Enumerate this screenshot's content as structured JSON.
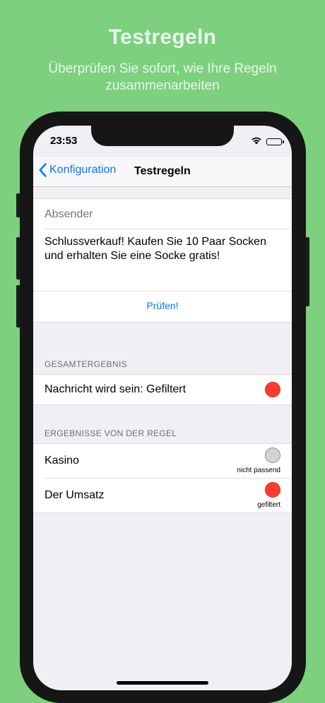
{
  "promo": {
    "title": "Testregeln",
    "subtitle": "Überprüfen Sie sofort, wie Ihre Regeln zusammenarbeiten"
  },
  "status_bar": {
    "time": "23:53",
    "icons": [
      "wifi-icon",
      "battery-icon"
    ]
  },
  "nav": {
    "back_label": "Konfiguration",
    "title": "Testregeln"
  },
  "form": {
    "sender_placeholder": "Absender",
    "sender_value": "",
    "message": "Schlussverkauf! Kaufen Sie 10 Paar Socken und erhalten Sie eine Socke gratis!",
    "check_label": "Prüfen!"
  },
  "overall": {
    "header": "GESAMTERGEBNIS",
    "label": "Nachricht wird sein: Gefiltert",
    "status_color": "#ff3b30"
  },
  "rules": {
    "header": "ERGEBNISSE VON DER REGEL",
    "items": [
      {
        "name": "Kasino",
        "status": "nicht passend",
        "status_color": "#d3d3d6"
      },
      {
        "name": "Der Umsatz",
        "status": "gefiltert",
        "status_color": "#ff3b30"
      }
    ]
  },
  "colors": {
    "background": "#7cd07e",
    "accent": "#007aff",
    "filtered": "#ff3b30"
  }
}
